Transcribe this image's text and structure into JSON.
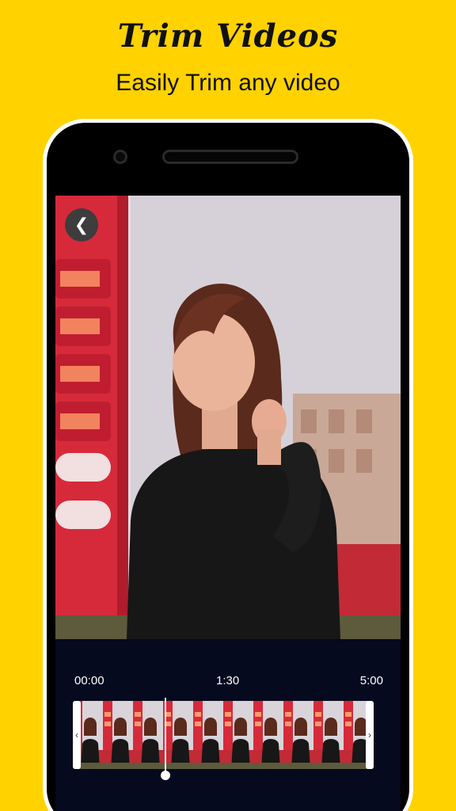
{
  "header": {
    "title": "Trim Videos",
    "subtitle": "Easily Trim any video"
  },
  "player": {
    "back_icon": "chevron-left-icon"
  },
  "timeline": {
    "start_time": "00:00",
    "mid_time": "1:30",
    "end_time": "5:00",
    "playhead_progress": 0.3
  },
  "colors": {
    "background": "#FFD200",
    "screen": "#050a1e",
    "accent_red": "#d8263a"
  }
}
